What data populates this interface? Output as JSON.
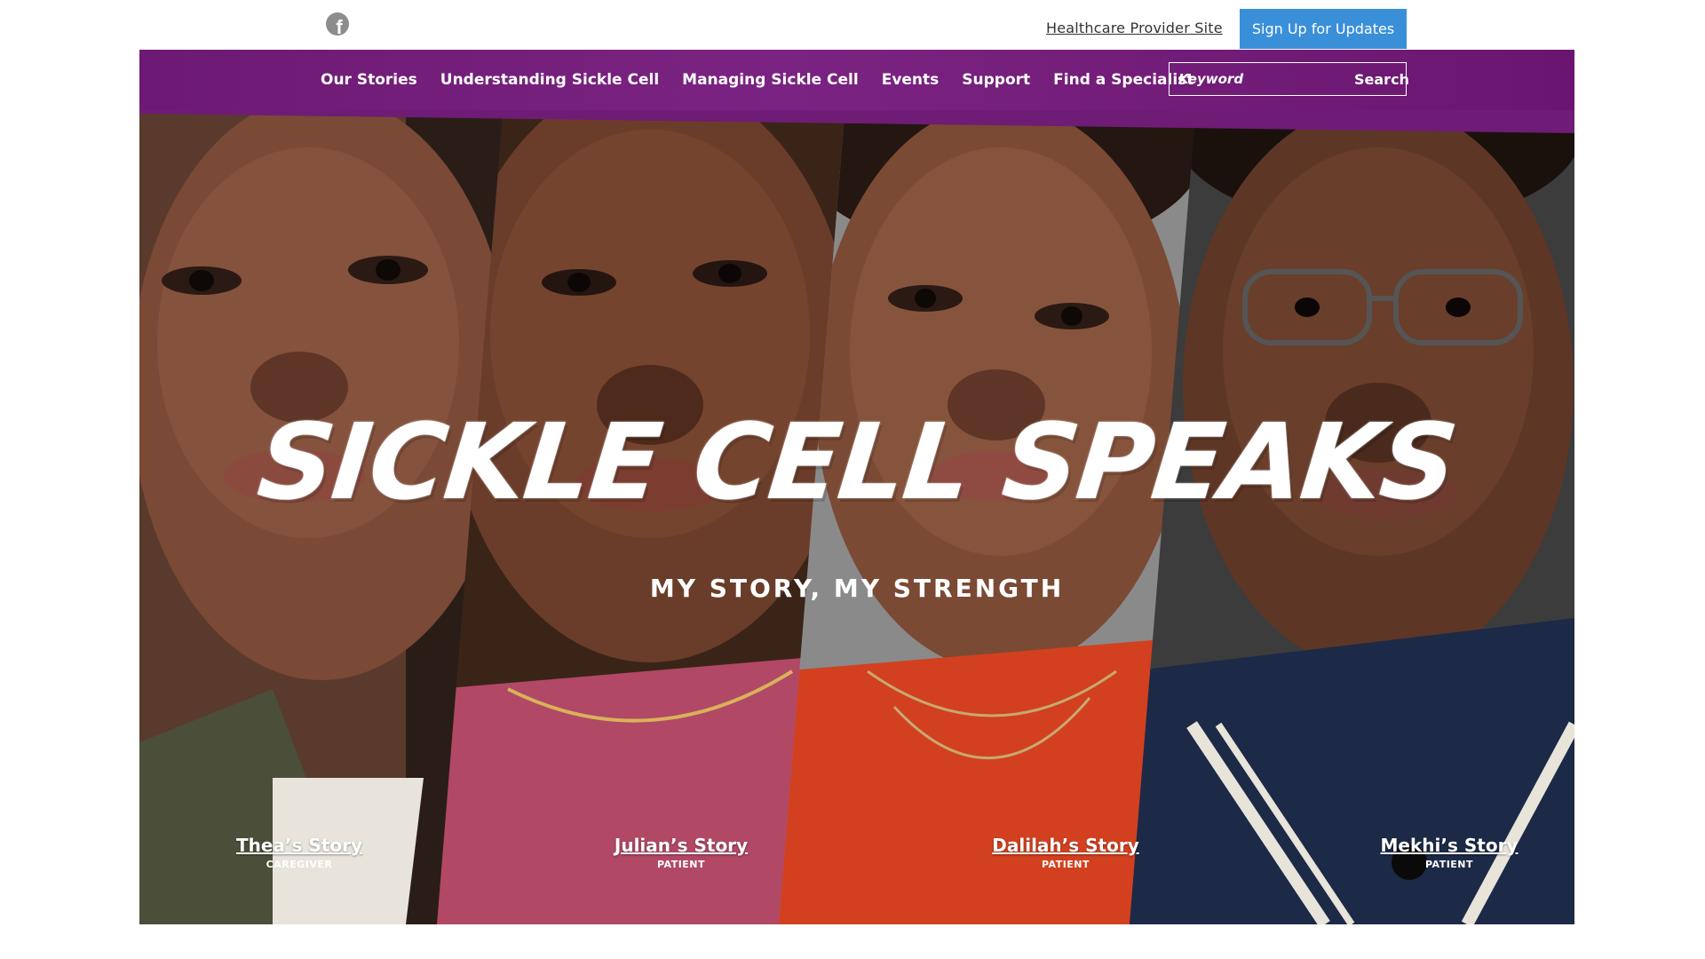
{
  "utility": {
    "social_icon": "facebook-icon",
    "healthcare_link": "Healthcare Provider Site",
    "signup_label": "Sign Up for Updates"
  },
  "nav": {
    "items": [
      "Our Stories",
      "Understanding Sickle Cell",
      "Managing Sickle Cell",
      "Events",
      "Support",
      "Find a Specialist"
    ],
    "search_placeholder": "Keyword",
    "search_label": "Search"
  },
  "hero": {
    "title": "SICKLE CELL SPEAKS",
    "subtitle": "MY STORY, MY STRENGTH",
    "stories": [
      {
        "label": "Thea’s Story",
        "role": "CAREGIVER"
      },
      {
        "label": "Julian’s Story",
        "role": "PATIENT"
      },
      {
        "label": "Dalilah’s Story",
        "role": "PATIENT"
      },
      {
        "label": "Mekhi’s Story",
        "role": "PATIENT"
      }
    ]
  },
  "colors": {
    "nav_purple": "#7b2382",
    "signup_blue": "#3a8fd9"
  }
}
